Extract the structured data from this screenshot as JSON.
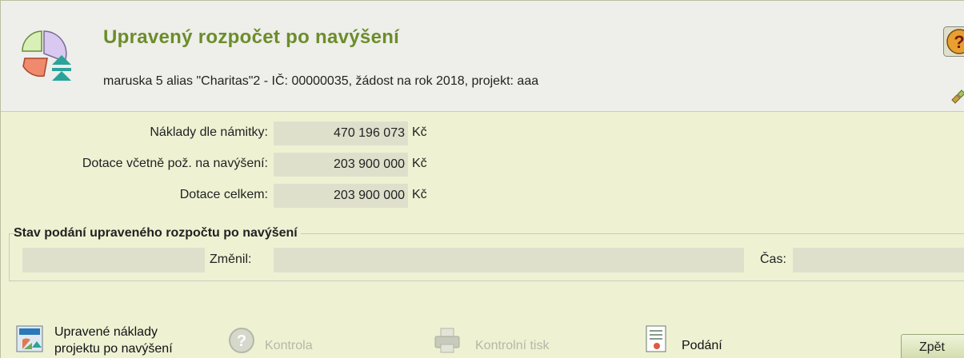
{
  "header": {
    "title": "Upravený rozpočet po navýšení",
    "subtitle": "maruska 5 alias \"Charitas\"2 - IČ: 00000035, žádost na rok 2018, projekt: aaa"
  },
  "summary": {
    "rows": [
      {
        "label": "Náklady dle námitky:",
        "value": "470 196 073",
        "currency": "Kč"
      },
      {
        "label": "Dotace včetně pož. na navýšení:",
        "value": "203 900 000",
        "currency": "Kč"
      },
      {
        "label": "Dotace celkem:",
        "value": "203 900 000",
        "currency": "Kč"
      }
    ]
  },
  "status": {
    "legend": "Stav podání upraveného rozpočtu po navýšení",
    "changed_by_label": "Změnil:",
    "time_label": "Čas:",
    "changed_by_value": "",
    "time_value": ""
  },
  "footer": {
    "costs_line1": "Upravené náklady",
    "costs_line2": "projektu po navýšení",
    "check_label": "Kontrola",
    "print_label": "Kontrolní tisk",
    "submit_label": "Podání",
    "back_label": "Zpět"
  },
  "icons": {
    "app": "pie-chart-icon",
    "help": "help-icon",
    "pin": "pin-icon",
    "costs": "costs-chart-icon",
    "check": "question-icon",
    "print": "printer-icon",
    "submit": "document-icon"
  },
  "colors": {
    "background": "#eef2d3",
    "header_bg": "#eeeeea",
    "title": "#6c8d2a",
    "field_bg": "#dfe0cc",
    "disabled_text": "#b4b8a6"
  }
}
